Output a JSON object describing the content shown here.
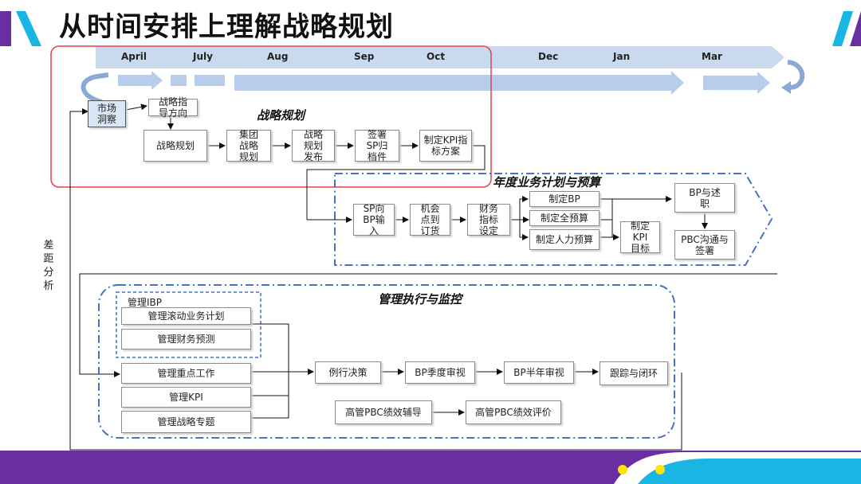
{
  "title": "从时间安排上理解战略规划",
  "timeline": {
    "months": [
      "April",
      "July",
      "Aug",
      "Sep",
      "Oct",
      "Dec",
      "Jan",
      "Mar"
    ]
  },
  "strategy": {
    "title": "战略规划",
    "market_insight": "市场洞察",
    "direction": "战略指导方向",
    "steps": [
      "战略规划",
      "集团战略规划",
      "战略规划发布",
      "签署SP归档件",
      "制定KPI指标方案"
    ]
  },
  "annual": {
    "title": "年度业务计划与预算",
    "steps": [
      "SP向BP输入",
      "机会点到订货",
      "财务指标设定"
    ],
    "plans": [
      "制定BP",
      "制定全预算",
      "制定人力预算"
    ],
    "kpi": "制定KPI目标",
    "bp_report": "BP与述职",
    "pbc": "PBC沟通与签署"
  },
  "exec": {
    "title": "管理执行与监控",
    "ibp": {
      "title": "管理IBP",
      "items": [
        "管理滚动业务计划",
        "管理财务预测"
      ]
    },
    "items": [
      "管理重点工作",
      "管理KPI",
      "管理战略专题"
    ],
    "flow": [
      "例行决策",
      "BP季度审视",
      "BP半年审视",
      "跟踪与闭环"
    ],
    "pbc_flow": [
      "高管PBC绩效辅导",
      "高管PBC绩效评价"
    ]
  },
  "gap_analysis": "差距分析",
  "colors": {
    "purple": "#6a2ea3",
    "cyan": "#19b5e5",
    "timeline": "#c9d9ee",
    "arrow": "#b7cdeb",
    "dashed": "#4472c4",
    "highlight": "#e8404a"
  }
}
